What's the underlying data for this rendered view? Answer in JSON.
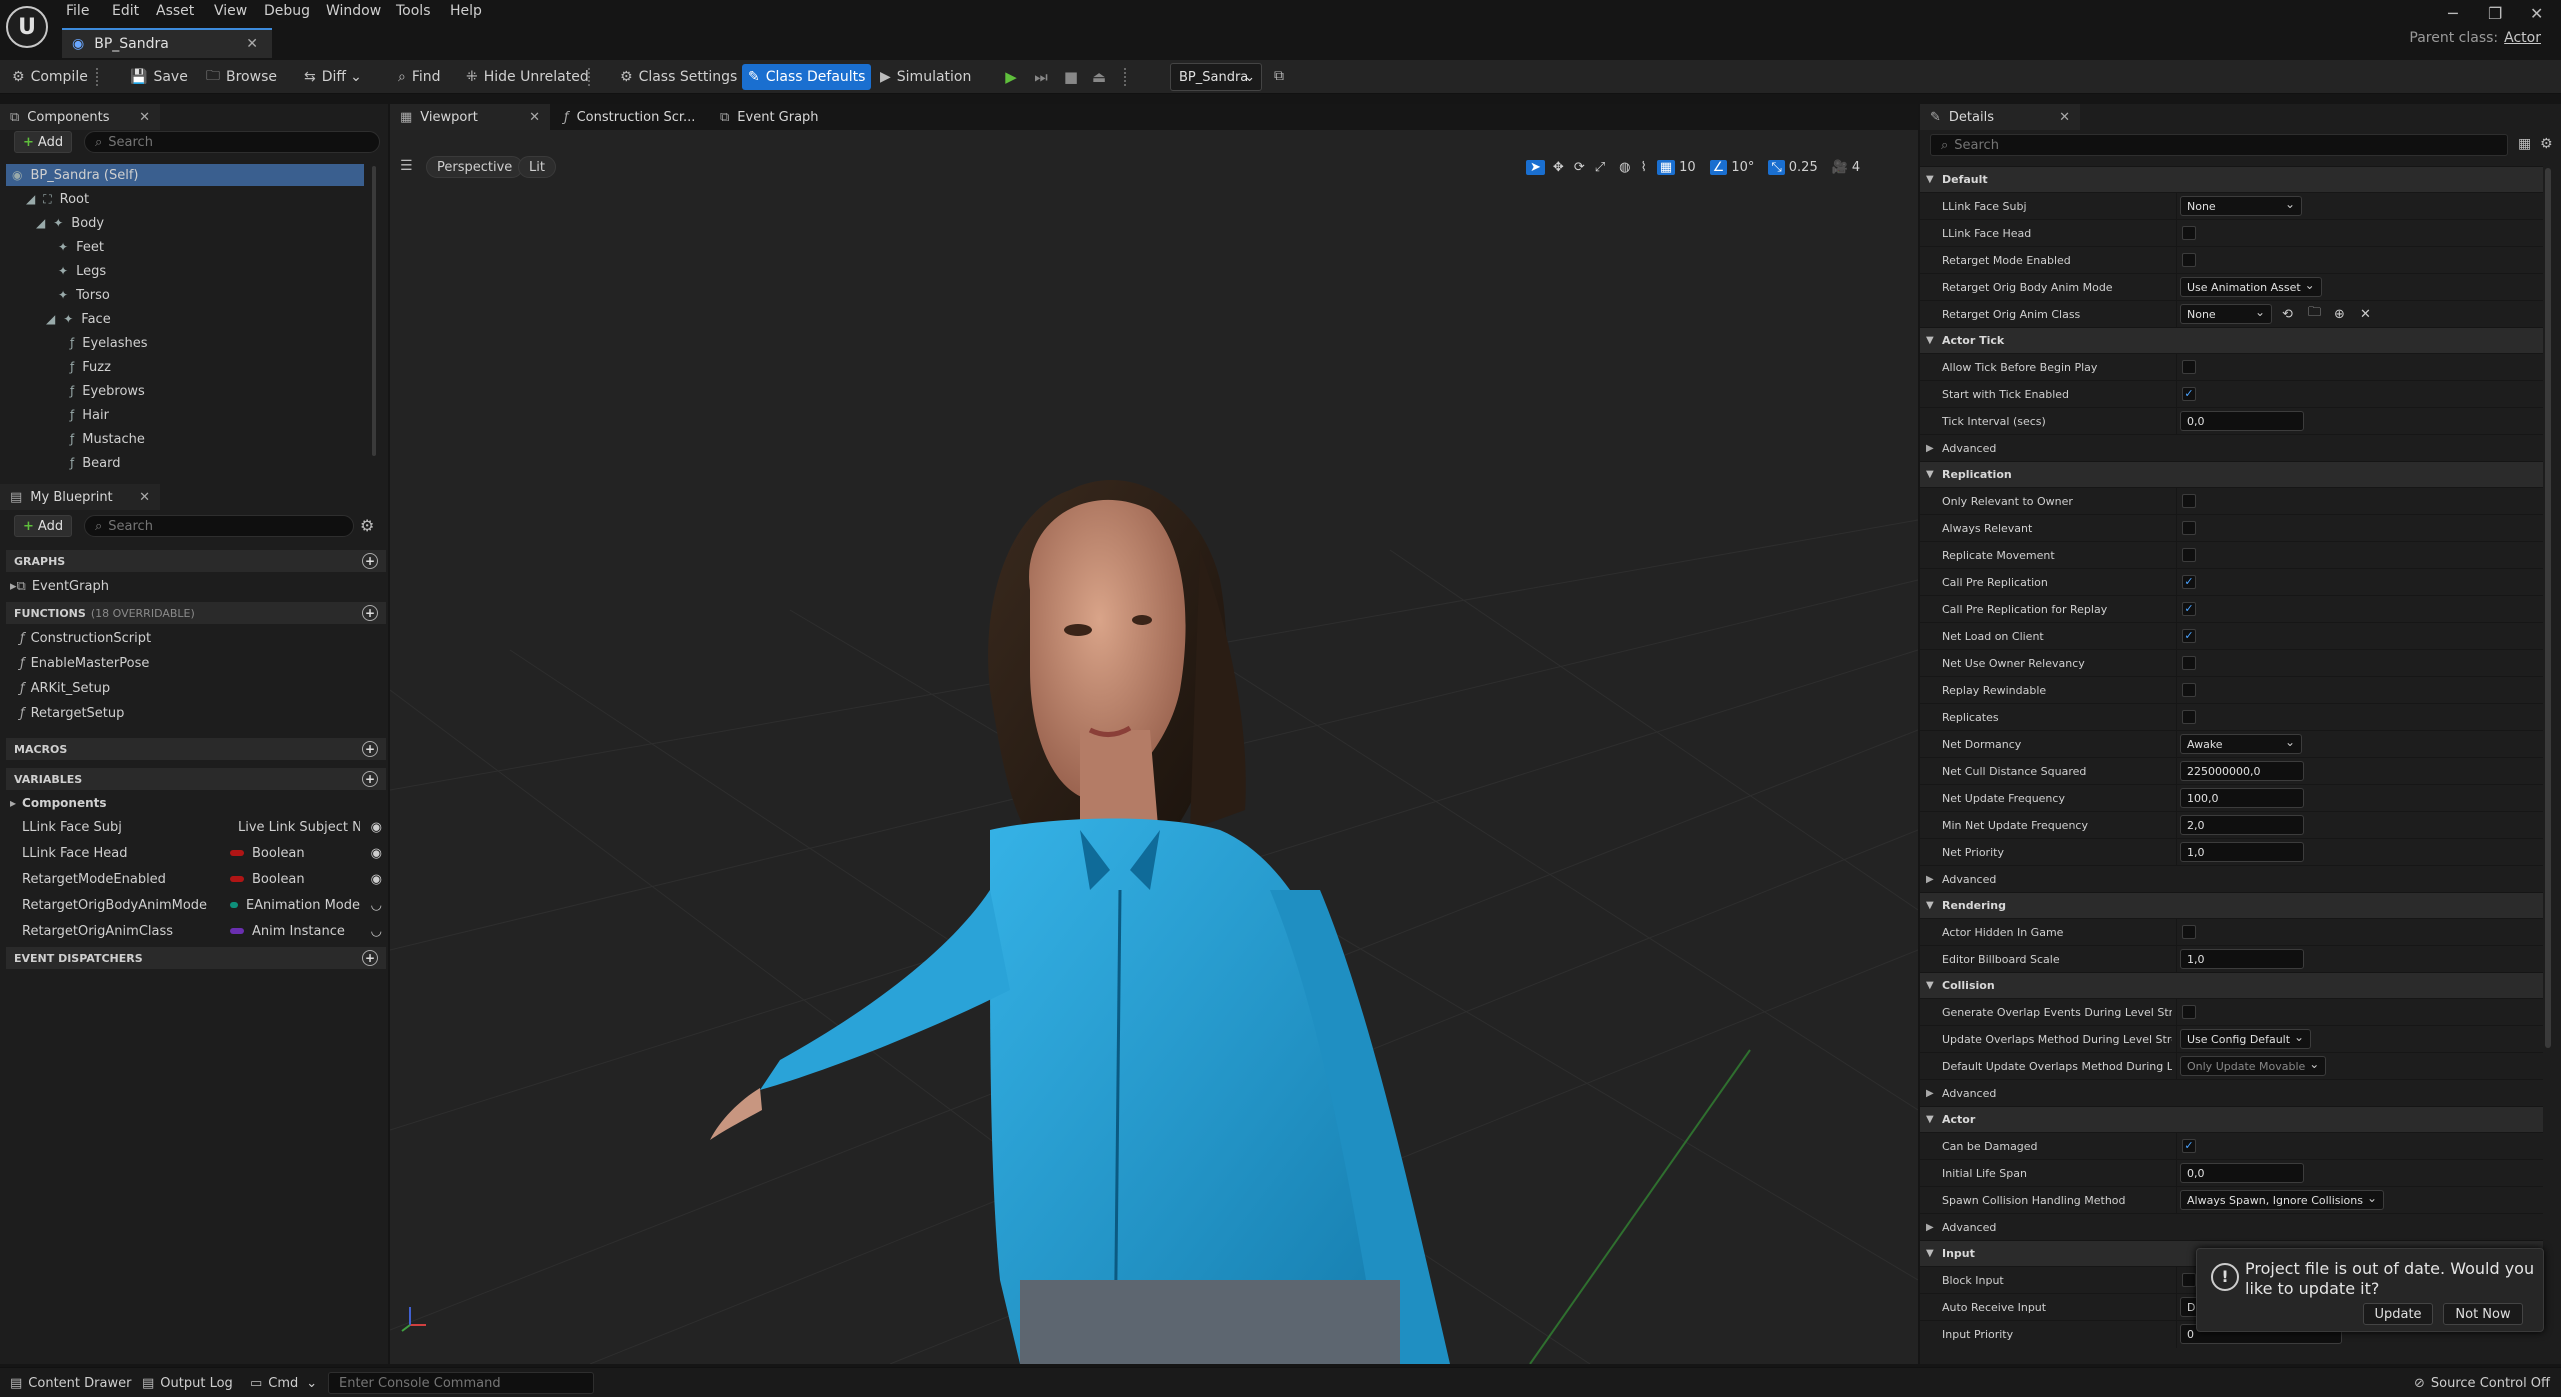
{
  "menu": [
    "File",
    "Edit",
    "Asset",
    "View",
    "Debug",
    "Window",
    "Tools",
    "Help"
  ],
  "doc_tab": "BP_Sandra",
  "parent_class": {
    "label": "Parent class:",
    "value": "Actor"
  },
  "toolbar": {
    "compile": "Compile",
    "save": "Save",
    "browse": "Browse",
    "diff": "Diff",
    "find": "Find",
    "hide_unrelated": "Hide Unrelated",
    "class_settings": "Class Settings",
    "class_defaults": "Class Defaults",
    "simulation": "Simulation",
    "debug_object": "BP_Sandra"
  },
  "components": {
    "tab": "Components",
    "add": "Add",
    "search_placeholder": "Search",
    "items": [
      "BP_Sandra (Self)",
      "Root",
      "Body",
      "Feet",
      "Legs",
      "Torso",
      "Face",
      "Eyelashes",
      "Fuzz",
      "Eyebrows",
      "Hair",
      "Mustache",
      "Beard"
    ]
  },
  "my_blueprint": {
    "tab": "My Blueprint",
    "add": "Add",
    "search_placeholder": "Search",
    "graphs": "GRAPHS",
    "event_graph": "EventGraph",
    "functions": "FUNCTIONS",
    "functions_sub": "(18 OVERRIDABLE)",
    "function_items": [
      "ConstructionScript",
      "EnableMasterPose",
      "ARKit_Setup",
      "RetargetSetup"
    ],
    "macros": "MACROS",
    "variables": "VARIABLES",
    "var_group": "Components",
    "variables_list": [
      {
        "name": "LLink Face Subj",
        "type": "Live Link Subject N",
        "color": "#1e6fd8"
      },
      {
        "name": "LLink Face Head",
        "type": "Boolean",
        "color": "#b01515"
      },
      {
        "name": "RetargetModeEnabled",
        "type": "Boolean",
        "color": "#b01515"
      },
      {
        "name": "RetargetOrigBodyAnimMode",
        "type": "EAnimation Mode",
        "color": "#0e8f7a"
      },
      {
        "name": "RetargetOrigAnimClass",
        "type": "Anim Instance",
        "color": "#6a2fb0"
      }
    ],
    "event_dispatchers": "EVENT DISPATCHERS"
  },
  "editor_tabs": [
    "Viewport",
    "Construction Scr...",
    "Event Graph"
  ],
  "viewport": {
    "perspective": "Perspective",
    "lit": "Lit",
    "grid": "10",
    "angle": "10°",
    "scale": "0.25",
    "camera": "4"
  },
  "details": {
    "tab": "Details",
    "search_placeholder": "Search",
    "default_cat": "Default",
    "llink_face_subj": "LLink Face Subj",
    "llink_face_subj_val": "None",
    "llink_face_head": "LLink Face Head",
    "retarget_mode": "Retarget Mode Enabled",
    "retarget_body_mode": "Retarget Orig Body Anim Mode",
    "retarget_body_mode_val": "Use Animation Asset",
    "retarget_anim_class": "Retarget Orig Anim Class",
    "retarget_anim_class_val": "None",
    "actor_tick_cat": "Actor Tick",
    "allow_tick": "Allow Tick Before Begin Play",
    "start_tick": "Start with Tick Enabled",
    "tick_interval": "Tick Interval (secs)",
    "tick_interval_val": "0,0",
    "advanced": "Advanced",
    "replication_cat": "Replication",
    "only_relevant": "Only Relevant to Owner",
    "always_relevant": "Always Relevant",
    "replicate_movement": "Replicate Movement",
    "call_pre_rep": "Call Pre Replication",
    "call_pre_rep_replay": "Call Pre Replication for Replay",
    "net_load": "Net Load on Client",
    "net_use_owner": "Net Use Owner Relevancy",
    "replay_rewindable": "Replay Rewindable",
    "replicates": "Replicates",
    "net_dormancy": "Net Dormancy",
    "net_dormancy_val": "Awake",
    "net_cull": "Net Cull Distance Squared",
    "net_cull_val": "225000000,0",
    "net_update_freq": "Net Update Frequency",
    "net_update_freq_val": "100,0",
    "min_net_update": "Min Net Update Frequency",
    "min_net_update_val": "2,0",
    "net_priority": "Net Priority",
    "net_priority_val": "1,0",
    "rendering_cat": "Rendering",
    "actor_hidden": "Actor Hidden In Game",
    "billboard_scale": "Editor Billboard Scale",
    "billboard_scale_val": "1,0",
    "collision_cat": "Collision",
    "gen_overlap": "Generate Overlap Events During Level Stre...",
    "update_overlaps": "Update Overlaps Method During Level Stre...",
    "update_overlaps_val": "Use Config Default",
    "default_update_overlaps": "Default Update Overlaps Method During Le...",
    "default_update_overlaps_val": "Only Update Movable",
    "actor_cat": "Actor",
    "can_be_damaged": "Can be Damaged",
    "initial_life": "Initial Life Span",
    "initial_life_val": "0,0",
    "spawn_collision": "Spawn Collision Handling Method",
    "spawn_collision_val": "Always Spawn, Ignore Collisions",
    "input_cat": "Input",
    "block_input": "Block Input",
    "auto_receive": "Auto Receive Input",
    "auto_receive_val": "D",
    "input_priority": "Input Priority",
    "input_priority_val": "0"
  },
  "toast": {
    "message": "Project file is out of date. Would you like to update it?",
    "update": "Update",
    "not_now": "Not Now"
  },
  "statusbar": {
    "content_drawer": "Content Drawer",
    "output_log": "Output Log",
    "cmd": "Cmd",
    "console_placeholder": "Enter Console Command",
    "source_control": "Source Control Off"
  },
  "colors": {
    "accent": "#1a6fd0",
    "play_green": "#5fbf3c",
    "shirt": "#1f9fd6"
  }
}
